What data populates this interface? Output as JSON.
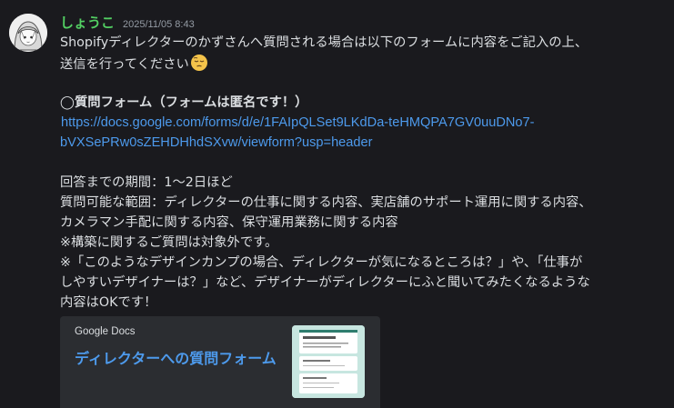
{
  "message": {
    "author": "しょうこ",
    "timestamp": "2025/11/05 8:43",
    "lines": [
      "Shopifyディレクターのかずさんへ質問される場合は以下のフォームに内容をご記入の上、",
      "送信を行ってください",
      "◯質問フォーム（フォームは匿名です！）",
      "回答までの期間：1〜2日ほど",
      "質問可能な範囲：ディレクターの仕事に関する内容、実店舗のサポート運用に関する内容、",
      "カメラマン手配に関する内容、保守運用業務に関する内容",
      "※構築に関するご質問は対象外です。",
      "※「このようなデザインカンプの場合、ディレクターが気になるところは？」や、「仕事が",
      "しやすいデザイナーは？」など、デザイナーがディレクターにふと聞いてみたくなるような",
      "内容はOKです！"
    ],
    "link": {
      "line1": "https://docs.google.com/forms/d/e/1FAIpQLSet9LKdDa-teHMQPA7GV0uuDNo7-",
      "line2": "bVXSePRw0sZEHDHhdSXvw/viewform?usp=header"
    },
    "emoji": "pensive-face-emoji"
  },
  "embed": {
    "provider": "Google Docs",
    "title": "ディレクターへの質問フォーム",
    "thumbnail": "google-form-preview"
  },
  "colors": {
    "background": "#1a1a1e",
    "author": "#53d063",
    "link": "#4d9aec",
    "text": "#dbdee1",
    "timestamp": "#949ba4",
    "embed_bg": "#2b2d31"
  }
}
